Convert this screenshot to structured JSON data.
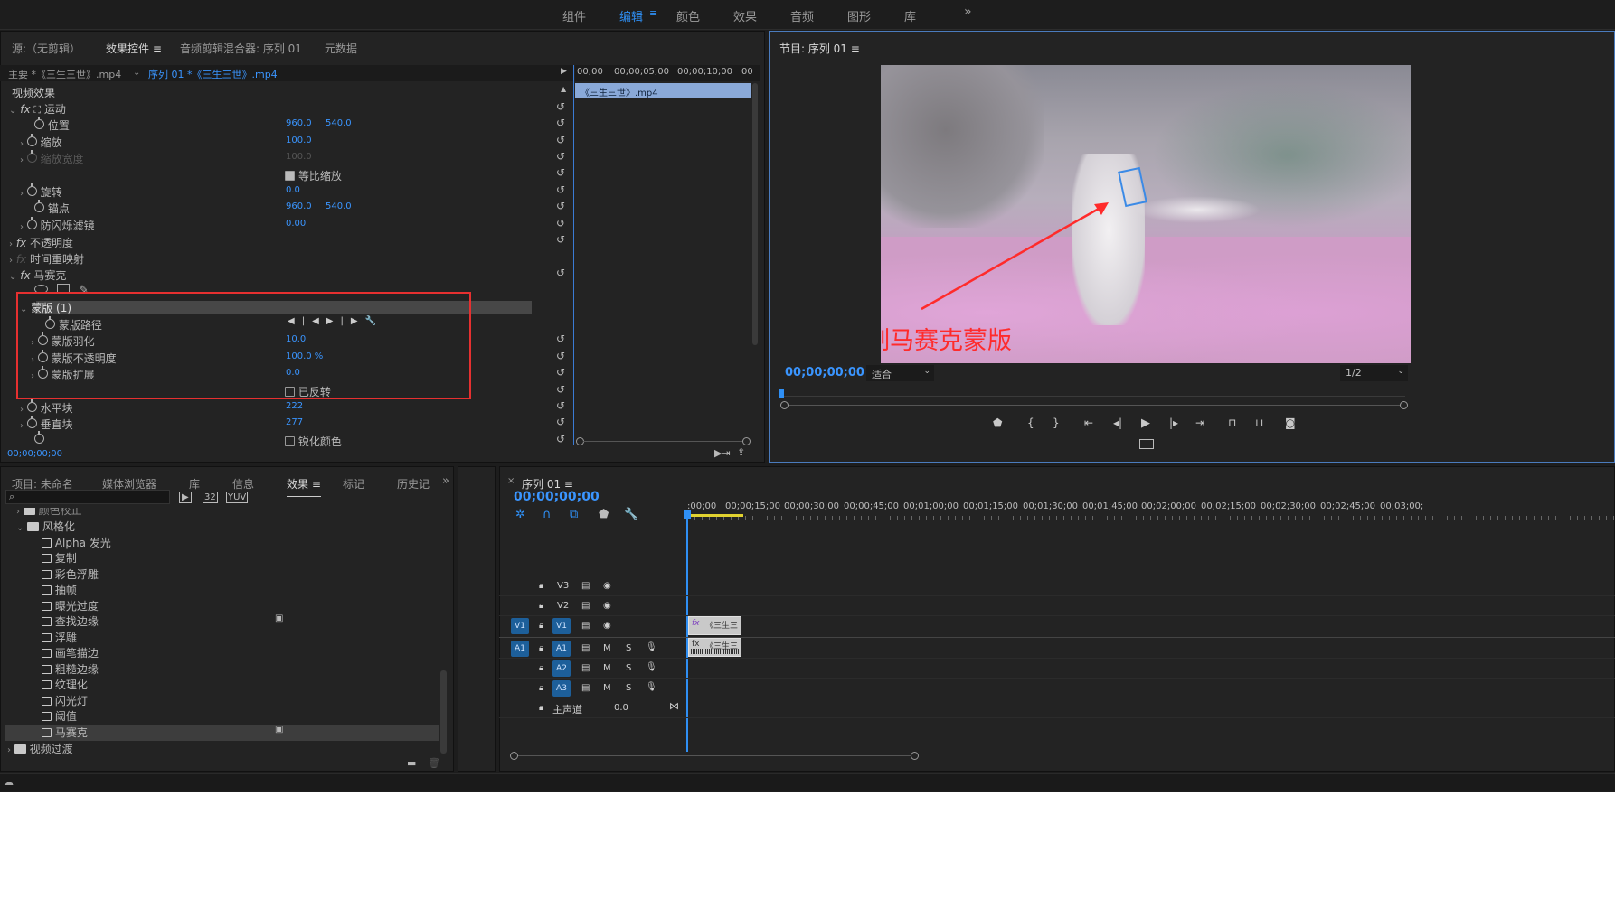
{
  "workspaces": {
    "items": [
      "组件",
      "编辑",
      "颜色",
      "效果",
      "音频",
      "图形",
      "库"
    ],
    "active": "编辑",
    "overflow": "»"
  },
  "source_panel": {
    "tabs": [
      "源:（无剪辑）",
      "效果控件",
      "音频剪辑混合器: 序列 01",
      "元数据"
    ],
    "active_tab": "效果控件",
    "menu_icon": "≡"
  },
  "effect_controls": {
    "master_clip": "主要 *《三生三世》.mp4",
    "sequence_clip": "序列 01 *《三生三世》.mp4",
    "section": "视频效果",
    "motion": "运动",
    "position_label": "位置",
    "position_x": "960.0",
    "position_y": "540.0",
    "scale_label": "缩放",
    "scale": "100.0",
    "scale_width_label": "缩放宽度",
    "scale_width": "100.0",
    "uniform_scale": "等比缩放",
    "rotation_label": "旋转",
    "rotation": "0.0",
    "anchor_label": "锚点",
    "anchor_x": "960.0",
    "anchor_y": "540.0",
    "flicker_label": "防闪烁滤镜",
    "flicker": "0.00",
    "opacity": "不透明度",
    "time_remap": "时间重映射",
    "mosaic": "马赛克",
    "mask": "蒙版 (1)",
    "mask_path": "蒙版路径",
    "mask_feather_label": "蒙版羽化",
    "mask_feather": "10.0",
    "mask_opacity_label": "蒙版不透明度",
    "mask_opacity": "100.0 %",
    "mask_expand_label": "蒙版扩展",
    "mask_expand": "0.0",
    "inverted": "已反转",
    "hblocks_label": "水平块",
    "hblocks": "222",
    "vblocks_label": "垂直块",
    "vblocks": "277",
    "sharpen": "锐化颜色",
    "timecode": "00;00;00;00",
    "ruler": [
      "00;00",
      "00;00;05;00",
      "00;00;10;00",
      "00"
    ],
    "clip_bar": "《三生三世》.mp4"
  },
  "program": {
    "title": "节目: 序列 01",
    "menu_icon": "≡",
    "timecode": "00;00;00;00",
    "fit": "适合",
    "resolution": "1/2",
    "annotation": "绘制马赛克蒙版",
    "annotation_color": "#ff2b2b"
  },
  "project_panel": {
    "tabs": [
      "项目: 未命名",
      "媒体浏览器",
      "库",
      "信息",
      "效果",
      "标记",
      "历史记"
    ],
    "active_tab": "效果",
    "items": [
      {
        "label": "颜色校正",
        "type": "folder"
      },
      {
        "label": "风格化",
        "type": "folder"
      },
      {
        "label": "Alpha 发光",
        "type": "fx"
      },
      {
        "label": "复制",
        "type": "fx"
      },
      {
        "label": "彩色浮雕",
        "type": "fx"
      },
      {
        "label": "抽帧",
        "type": "fx"
      },
      {
        "label": "曝光过度",
        "type": "fx"
      },
      {
        "label": "查找边缘",
        "type": "fx"
      },
      {
        "label": "浮雕",
        "type": "fx"
      },
      {
        "label": "画笔描边",
        "type": "fx"
      },
      {
        "label": "粗糙边缘",
        "type": "fx"
      },
      {
        "label": "纹理化",
        "type": "fx"
      },
      {
        "label": "闪光灯",
        "type": "fx"
      },
      {
        "label": "阈值",
        "type": "fx"
      },
      {
        "label": "马赛克",
        "type": "fx"
      },
      {
        "label": "视频过渡",
        "type": "folder"
      }
    ]
  },
  "timeline": {
    "tab": "序列 01",
    "menu_icon": "≡",
    "timecode": "00;00;00;00",
    "ruler": [
      ":00;00",
      "00;00;15;00",
      "00;00;30;00",
      "00;00;45;00",
      "00;01;00;00",
      "00;01;15;00",
      "00;01;30;00",
      "00;01;45;00",
      "00;02;00;00",
      "00;02;15;00",
      "00;02;30;00",
      "00;02;45;00",
      "00;03;00;"
    ],
    "tracks": {
      "v3": "V3",
      "v2": "V2",
      "v1": "V1",
      "a1": "A1",
      "a2": "A2",
      "a3": "A3",
      "m": "M",
      "s": "S",
      "master": "主声道",
      "master_val": "0.0"
    },
    "clip_label": "《三生三"
  },
  "colors": {
    "accent": "#2f8ff4",
    "mask_box": "#e63030"
  }
}
